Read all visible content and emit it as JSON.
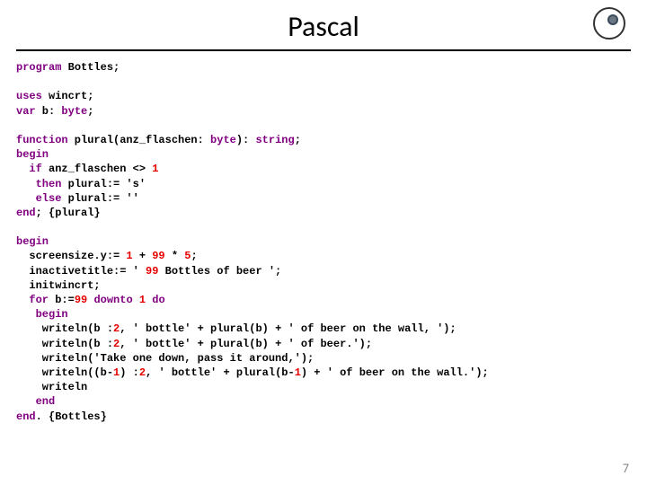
{
  "title": "Pascal",
  "page_number": "7",
  "kw": {
    "program": "program",
    "uses": "uses",
    "var": "var",
    "byte": "byte",
    "function": "function",
    "string": "string",
    "begin": "begin",
    "if": "if",
    "then": "then",
    "else": "else",
    "end": "end",
    "for": "for",
    "downto": "downto",
    "do": "do"
  },
  "txt": {
    "l1": " Bottles;",
    "l2a": " wincrt;",
    "l2b": " b: ",
    "l2c": ";",
    "l3a": " plural(anz_flaschen: ",
    "l3b": "): ",
    "l3c": ";",
    "l4": " anz_flaschen <> ",
    "l5": " plural:= 's'",
    "l6": " plural:= ''",
    "l7": "; {plural}",
    "l8a": "  screensize.y:= ",
    "l8b": " + ",
    "l8c": " * ",
    "l8d": ";",
    "l9a": "  inactivetitle:= ' ",
    "l9b": " Bottles of beer ';",
    "l10": "  initwincrt;",
    "l11a": " b:=",
    "l11b": " ",
    "l11c": " ",
    "l12a": "    writeln(b :",
    "l12b": ", ' bottle' + plural(b) + ' of beer on the wall, ');",
    "l13a": "    writeln(b :",
    "l13b": ", ' bottle' + plural(b) + ' of beer.');",
    "l14": "    writeln('Take one down, pass it around,');",
    "l15a": "    writeln((b-",
    "l15b": ") :",
    "l15c": ", ' bottle' + plural(b-",
    "l15d": ") + ' of beer on the wall.');",
    "l16": "    writeln",
    "l17": ". {Bottles}"
  },
  "num": {
    "n1": "1",
    "n99": "99",
    "n5": "5",
    "n2": "2"
  }
}
